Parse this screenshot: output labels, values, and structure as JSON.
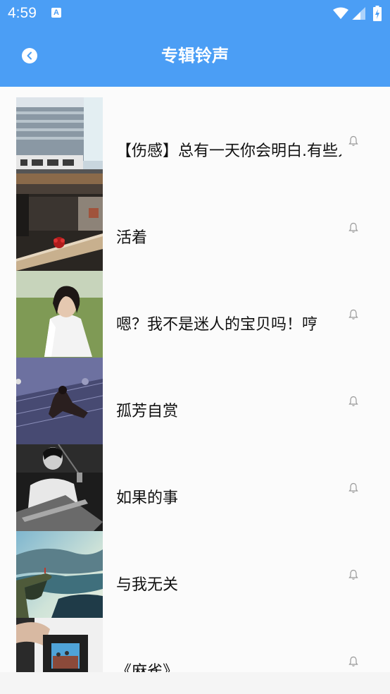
{
  "status_bar": {
    "time": "4:59",
    "notification_icon": "A",
    "background": "#4b9ef5"
  },
  "header": {
    "title": "专辑铃声",
    "back_icon": "back-arrow-icon"
  },
  "ringtones": [
    {
      "title": "【伤感】总有一天你会明白.有些人",
      "thumb": "train-station",
      "icon": "bell-icon"
    },
    {
      "title": "活着",
      "thumb": "cafe-table",
      "icon": "bell-icon"
    },
    {
      "title": "嗯？我不是迷人的宝贝吗！哼",
      "thumb": "girl-in-field",
      "icon": "bell-icon"
    },
    {
      "title": "孤芳自赏",
      "thumb": "person-on-stairs",
      "icon": "bell-icon"
    },
    {
      "title": "如果的事",
      "thumb": "guitar-player",
      "icon": "bell-icon"
    },
    {
      "title": "与我无关",
      "thumb": "cliff-landscape",
      "icon": "bell-icon"
    },
    {
      "title": "《麻雀》",
      "thumb": "hand-with-slide",
      "icon": "bell-icon"
    }
  ]
}
